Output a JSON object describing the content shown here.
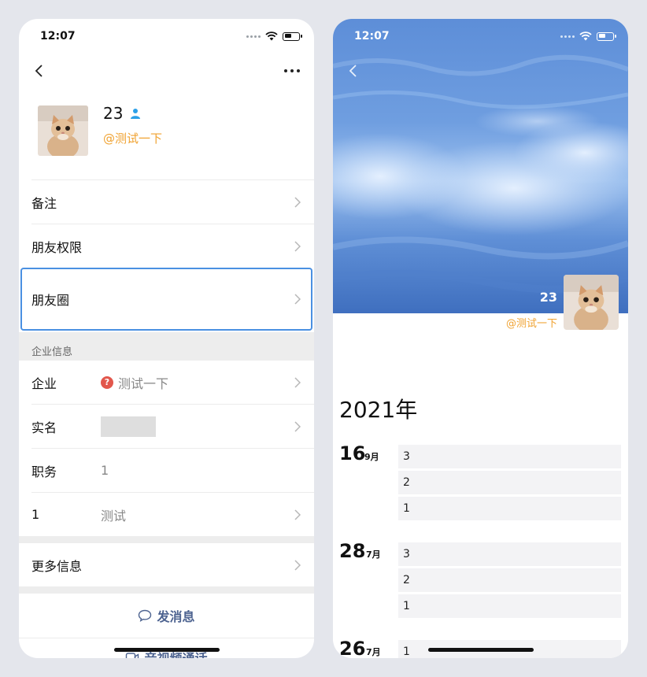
{
  "left_phone": {
    "status": {
      "time": "12:07"
    },
    "profile": {
      "name": "23",
      "handle": "@测试一下"
    },
    "rows": {
      "remark": "备注",
      "friend_permission": "朋友权限",
      "moments": "朋友圈"
    },
    "company_section": {
      "title": "企业信息",
      "company_label": "企业",
      "company_value": "测试一下",
      "realname_label": "实名",
      "position_label": "职务",
      "position_value": "1",
      "custom_label": "1",
      "custom_value": "测试"
    },
    "more_info": "更多信息",
    "actions": {
      "send_message": "发消息",
      "av_call": "音视频通话"
    },
    "colors": {
      "accent": "#4d6390",
      "handle": "#f0a230",
      "highlight": "#4a90e2"
    }
  },
  "right_phone": {
    "status": {
      "time": "12:07"
    },
    "cover": {
      "name": "23",
      "handle": "@测试一下"
    },
    "year": "2021年",
    "dates": [
      {
        "day": "16",
        "month": "9月",
        "posts": [
          "3",
          "2",
          "1"
        ]
      },
      {
        "day": "28",
        "month": "7月",
        "posts": [
          "3",
          "2",
          "1"
        ]
      },
      {
        "day": "26",
        "month": "7月",
        "posts": [
          "1"
        ]
      }
    ]
  }
}
